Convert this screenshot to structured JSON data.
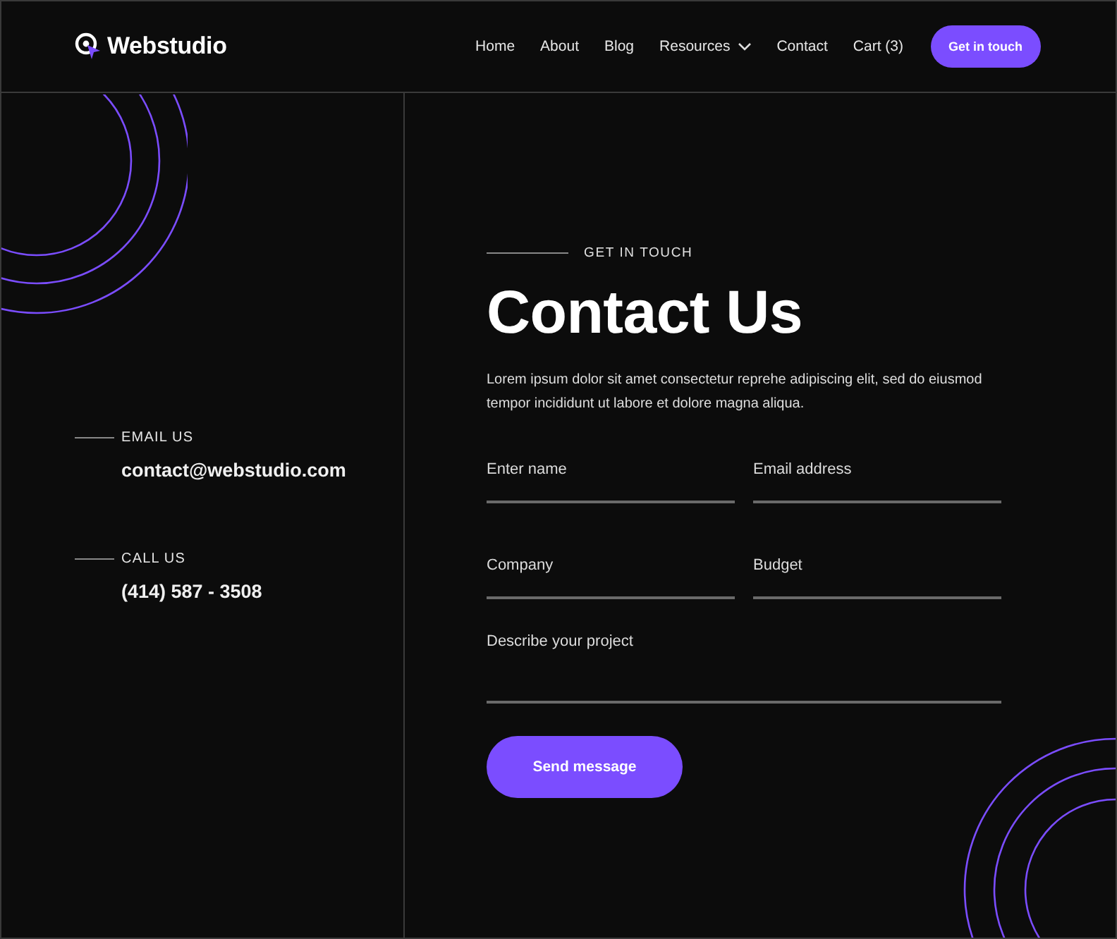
{
  "brand": {
    "name": "Webstudio"
  },
  "nav": [
    {
      "label": "Home",
      "kind": "link"
    },
    {
      "label": "About",
      "kind": "link"
    },
    {
      "label": "Blog",
      "kind": "link"
    },
    {
      "label": "Resources",
      "kind": "dropdown"
    },
    {
      "label": "Contact",
      "kind": "link"
    },
    {
      "label": "Cart (3)",
      "kind": "link"
    }
  ],
  "header_button": "Get in touch",
  "contacts": [
    {
      "label": "EMAIL US",
      "value": "contact@webstudio.com"
    },
    {
      "label": "CALL US",
      "value": "(414) 587 - 3508"
    }
  ],
  "eyebrow": "GET IN TOUCH",
  "title": "Contact Us",
  "intro": "Lorem ipsum dolor sit amet consectetur reprehe adipiscing elit, sed do eiusmod tempor incididunt ut labore et dolore magna aliqua.",
  "fields": [
    {
      "placeholder": "Enter name",
      "kind": "half"
    },
    {
      "placeholder": "Email address",
      "kind": "half"
    },
    {
      "placeholder": "Company",
      "kind": "half"
    },
    {
      "placeholder": "Budget",
      "kind": "half"
    },
    {
      "placeholder": "Describe your project",
      "kind": "full"
    }
  ],
  "submit": "Send message"
}
